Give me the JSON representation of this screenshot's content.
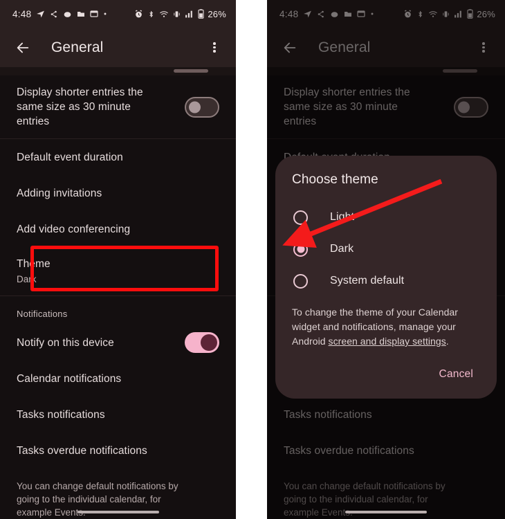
{
  "status_bar": {
    "time": "4:48",
    "battery_percent": "26%",
    "left_icons": [
      "navigation-icon",
      "bluetooth-share-icon",
      "cloud-icon",
      "folder-icon",
      "window-icon",
      "dot-icon"
    ],
    "right_icons": [
      "alarm-icon",
      "bluetooth-icon",
      "wifi-icon",
      "vibrate-icon",
      "signal-icon",
      "battery-icon"
    ]
  },
  "app_bar": {
    "title": "General",
    "back_icon": "back-arrow-icon",
    "overflow_icon": "more-vertical-icon"
  },
  "settings": {
    "display_shorter": {
      "title": "Display shorter entries the same size as 30 minute entries",
      "toggle_state": "off"
    },
    "items": [
      {
        "title": "Default event duration"
      },
      {
        "title": "Adding invitations"
      },
      {
        "title": "Add video conferencing"
      }
    ],
    "theme": {
      "title": "Theme",
      "value": "Dark"
    },
    "notifications_label": "Notifications",
    "notify_device": {
      "title": "Notify on this device",
      "toggle_state": "on"
    },
    "notification_items": [
      {
        "title": "Calendar notifications"
      },
      {
        "title": "Tasks notifications"
      },
      {
        "title": "Tasks overdue notifications"
      }
    ],
    "footnote": "You can change default notifications by going to the individual calendar, for example Events."
  },
  "dialog": {
    "title": "Choose theme",
    "options": [
      {
        "label": "Light",
        "selected": false
      },
      {
        "label": "Dark",
        "selected": true
      },
      {
        "label": "System default",
        "selected": false
      }
    ],
    "body_prefix": "To change the theme of your Calendar widget and notifications, manage your Android ",
    "body_link": "screen and display settings",
    "body_suffix": ".",
    "cancel_label": "Cancel"
  },
  "annotations": {
    "highlight_color": "#fc0d0d",
    "arrow_color": "#f41b1b",
    "highlight_target": "Theme",
    "arrow_target": "Dark"
  },
  "colors": {
    "accent_pink": "#f6bed2",
    "app_bar_bg": "#2b2020",
    "content_bg": "#140f10",
    "dialog_bg": "#352628"
  }
}
